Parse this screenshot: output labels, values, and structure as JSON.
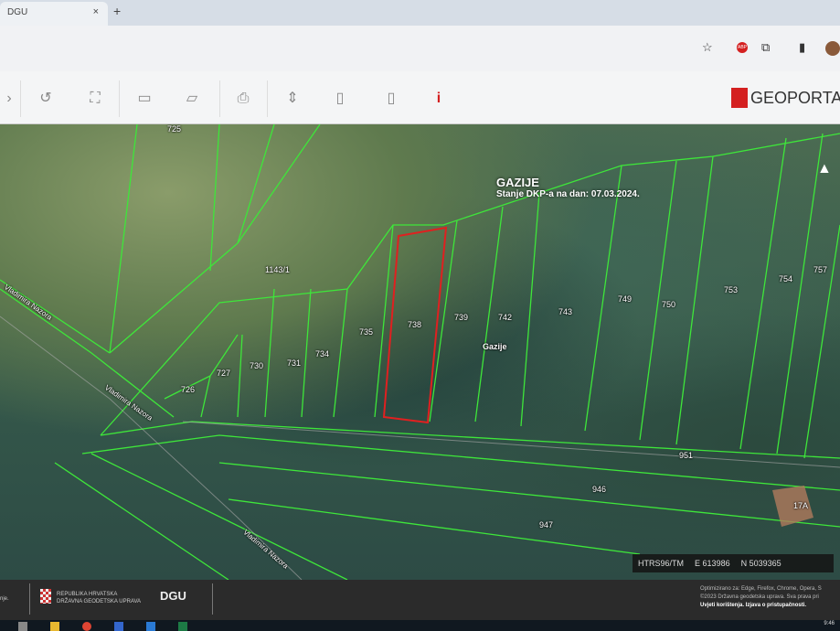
{
  "browser": {
    "tab_title": "DGU",
    "close": "×",
    "new_tab": "+",
    "abp": "ABP",
    "star": "☆"
  },
  "app": {
    "logo": "GEOPORTA",
    "info_icon": "i"
  },
  "map": {
    "title": "GAZIJE",
    "subtitle": "Stanje DKP-a na dan: 07.03.2024.",
    "north": "▲",
    "parcel_labels": [
      "725",
      "1143/1",
      "726",
      "727",
      "730",
      "731",
      "734",
      "735",
      "738",
      "739",
      "742",
      "743",
      "749",
      "750",
      "753",
      "754",
      "757",
      "951",
      "946",
      "947",
      "17A"
    ],
    "place_label": "Gazije",
    "street_labels": [
      "Vladimira Nazora",
      "Vladimira Nazora",
      "Vladimira Nazora"
    ],
    "selected_parcel": "738",
    "colors": {
      "parcel_lines": "#3ee63a",
      "selected": "#e02020"
    }
  },
  "coords": {
    "crs": "HTRS96/TM",
    "e_label": "E",
    "e_value": "613986",
    "n_label": "N",
    "n_value": "5039365"
  },
  "footer": {
    "left_text": "nje.",
    "org_line1": "REPUBLIKA HRVATSKA",
    "org_line2": "DRŽAVNA GEODETSKA UPRAVA",
    "dgu": "DGU",
    "r1": "Optimizirano za: Edge, Firefox, Chrome, Opera, S",
    "r2": "©2023 Državna geodetska uprava. Sva prava pri",
    "r3": "Uvjeti korištenja. Izjava o pristupačnosti."
  },
  "taskbar": {
    "clock": "9:46"
  }
}
